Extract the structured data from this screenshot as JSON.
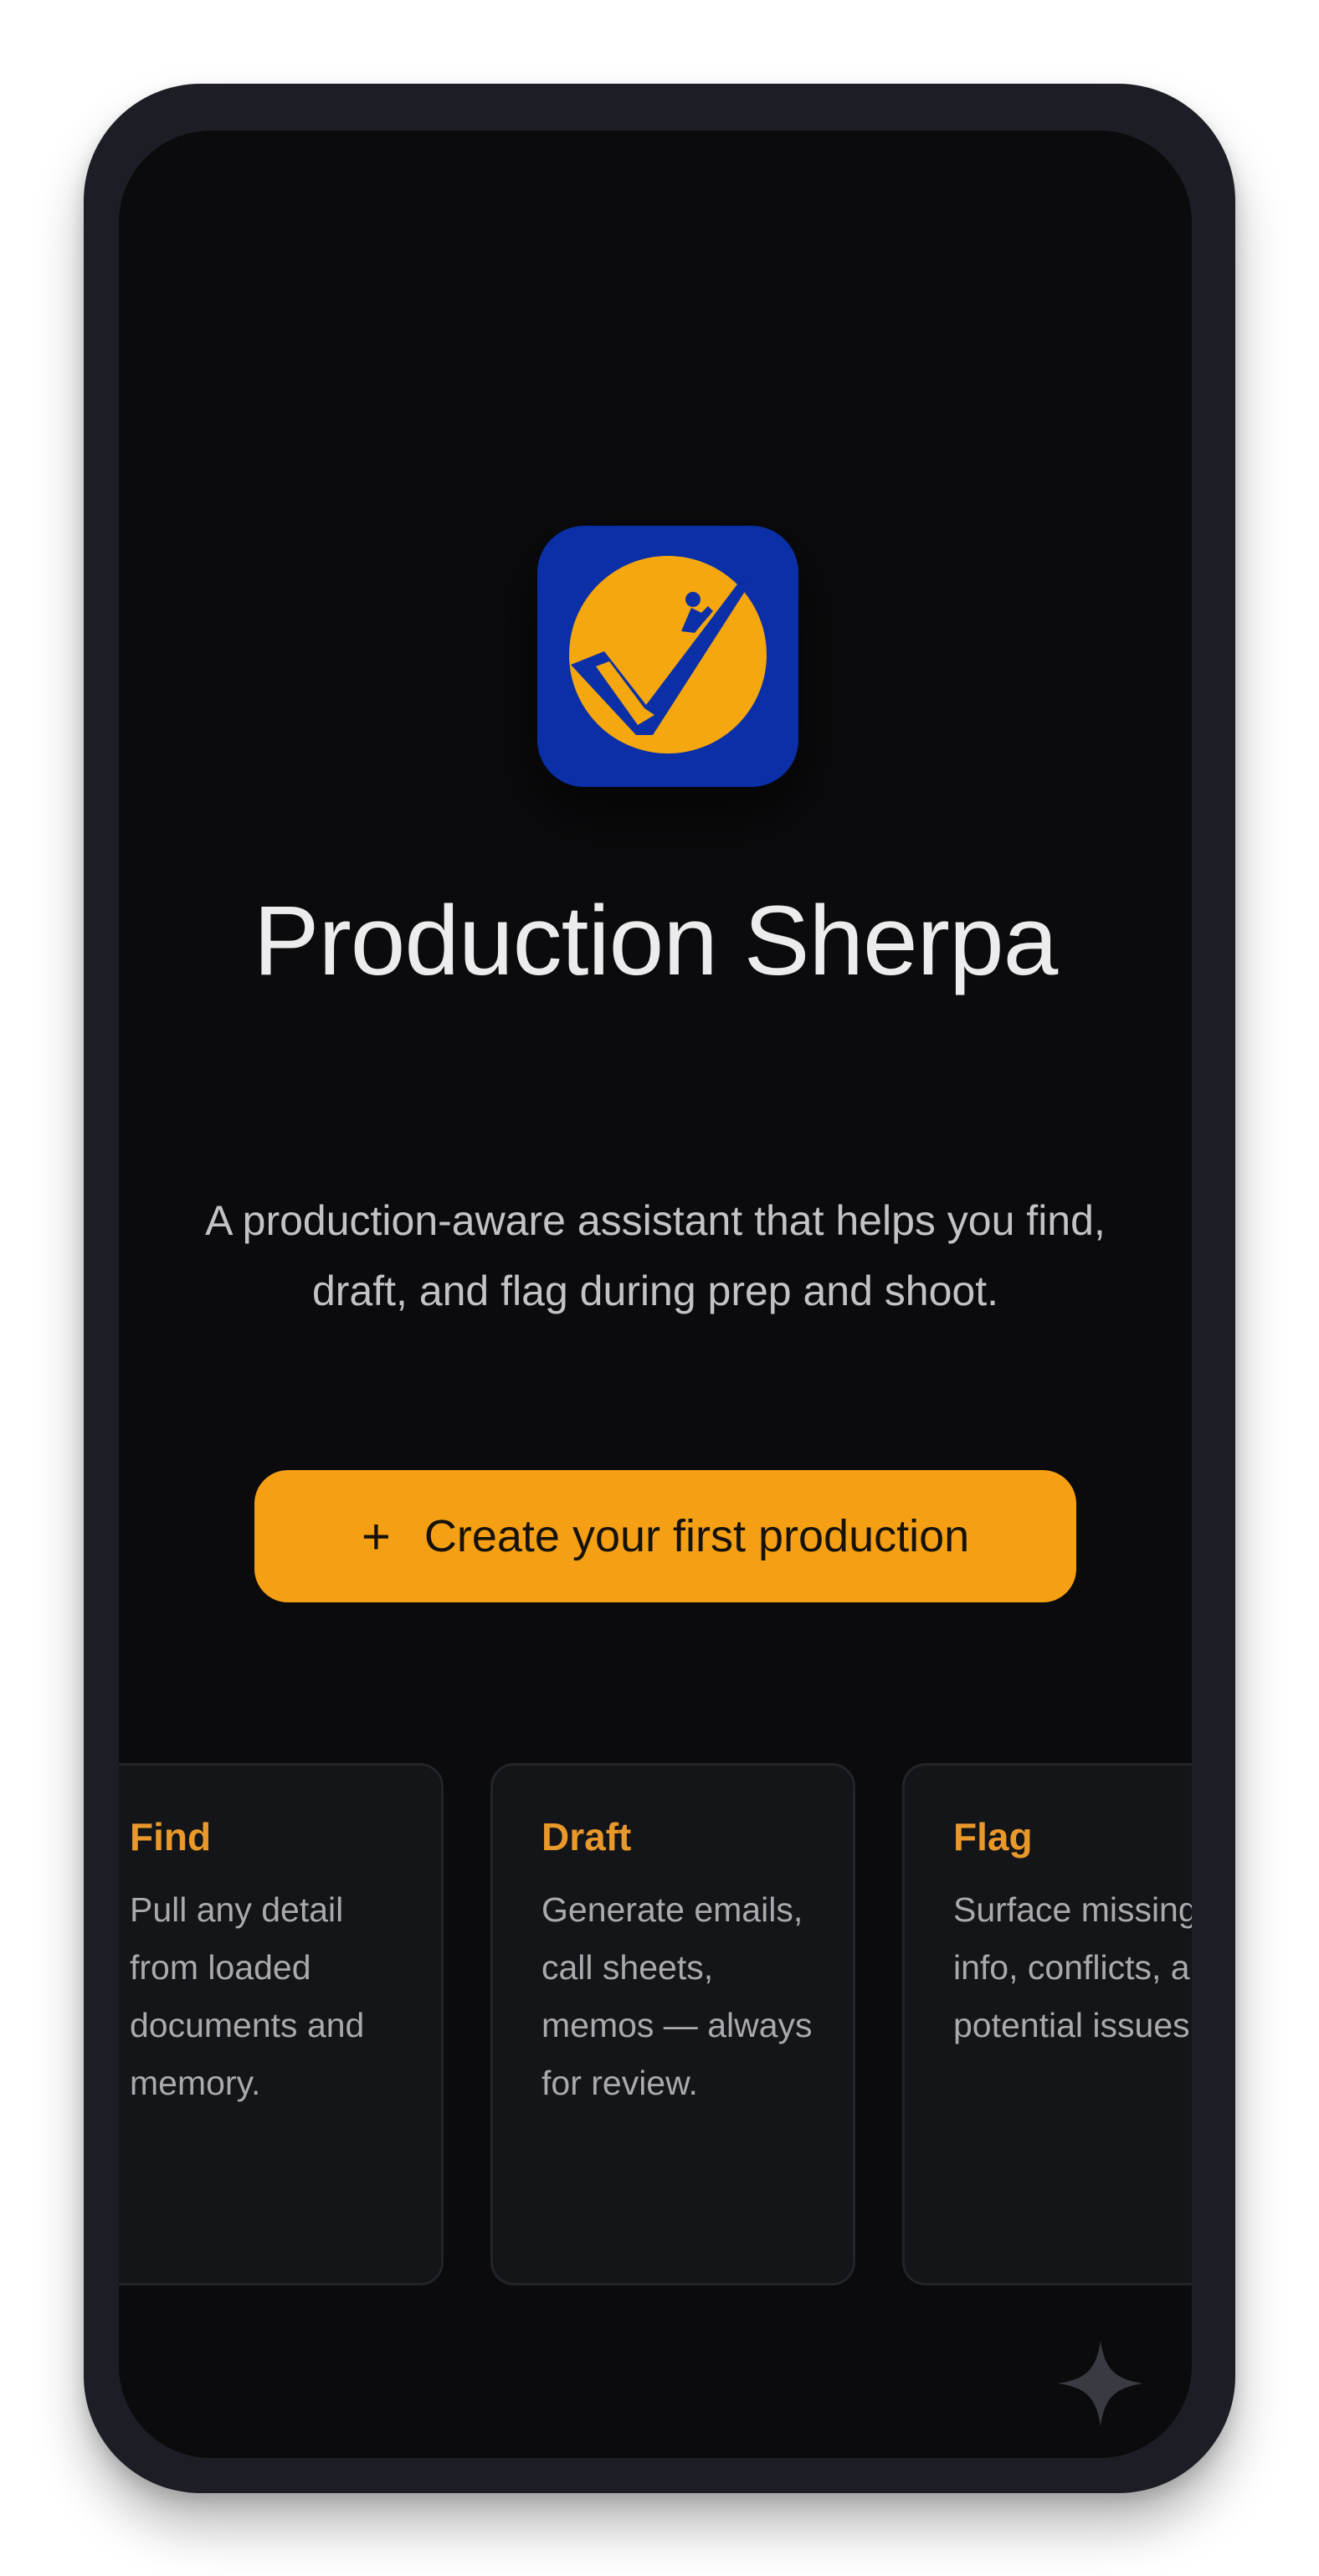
{
  "app": {
    "title": "Production Sherpa",
    "tagline_line1": "A production-aware assistant that helps you find,",
    "tagline_line2": "draft, and flag during prep and shoot.",
    "logo_icon": "checkmark-climber-logo-icon"
  },
  "cta": {
    "icon": "plus-icon",
    "icon_glyph": "+",
    "label": "Create your first production"
  },
  "features": [
    {
      "title": "Find",
      "body": "Pull any detail from loaded documents and memory."
    },
    {
      "title": "Draft",
      "body": "Generate emails, call sheets, memos — always for review."
    },
    {
      "title": "Flag",
      "body": "Surface missing info, conflicts, and potential issues."
    }
  ],
  "colors": {
    "accent": "#f5a014",
    "logo_bg": "#0b2fa6",
    "screen_bg": "#0b0b0d",
    "card_bg": "#141518"
  },
  "assistant_icon": "sparkle-icon"
}
